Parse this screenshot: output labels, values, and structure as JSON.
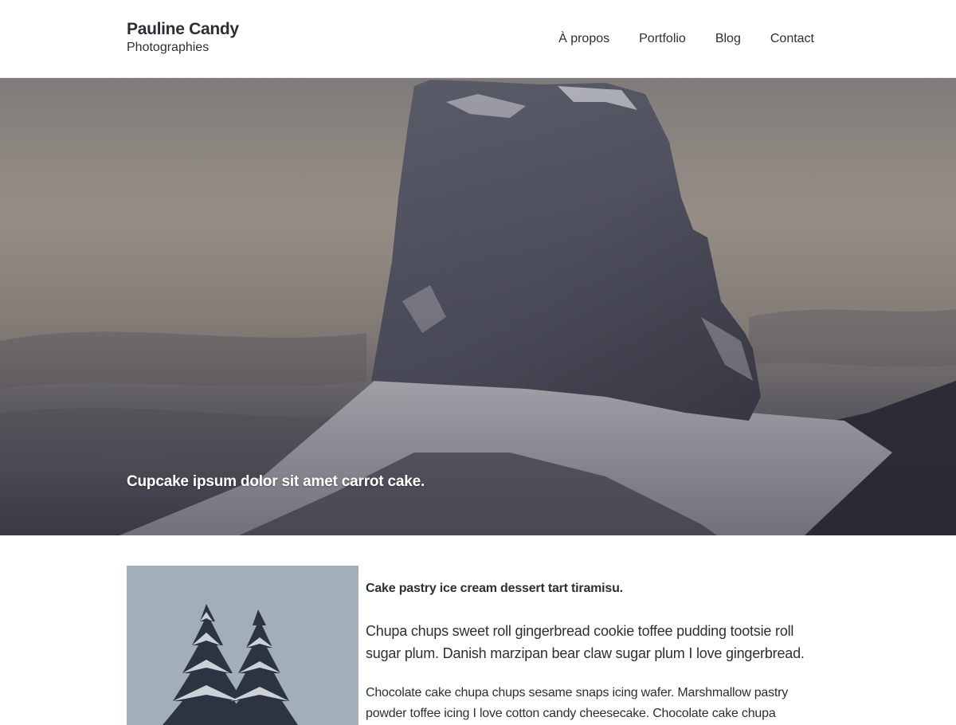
{
  "header": {
    "brand_name": "Pauline Candy",
    "brand_tagline": "Photographies",
    "nav": [
      {
        "label": "À propos"
      },
      {
        "label": "Portfolio"
      },
      {
        "label": "Blog"
      },
      {
        "label": "Contact"
      }
    ]
  },
  "hero": {
    "caption": "Cupcake ipsum dolor sit amet carrot cake."
  },
  "article": {
    "lead": "Cake pastry ice cream dessert tart tiramisu.",
    "paragraph_1": "Chupa chups sweet roll gingerbread cookie toffee pudding tootsie roll sugar plum. Danish marzipan bear claw sugar plum I love gingerbread.",
    "paragraph_2": "Chocolate cake chupa chups sesame snaps icing wafer. Marshmallow pastry powder toffee icing I love cotton candy cheesecake. Chocolate cake chupa"
  }
}
